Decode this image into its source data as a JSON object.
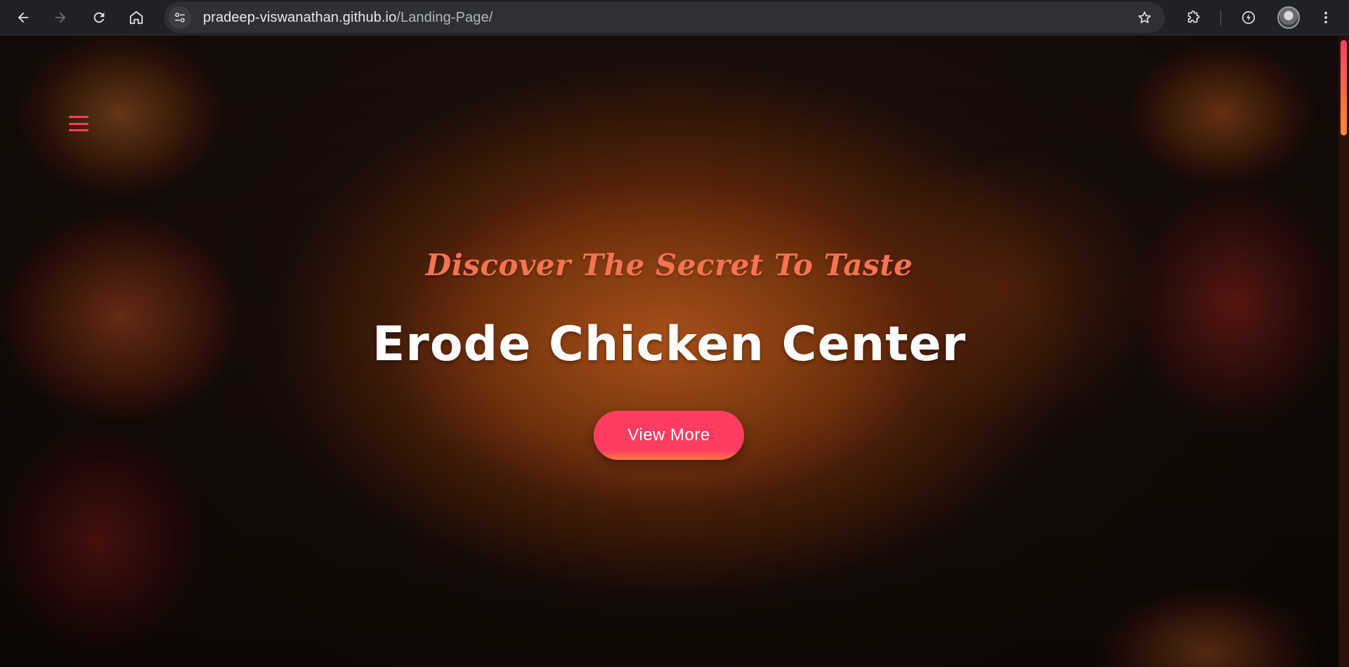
{
  "browser": {
    "url_host": "pradeep-viswanathan.github.io",
    "url_path": "/Landing-Page/",
    "icons": {
      "back": "arrow-left-icon",
      "forward": "arrow-right-icon",
      "reload": "reload-icon",
      "home": "home-icon",
      "site_info": "tune-icon",
      "bookmark": "star-icon",
      "extensions": "puzzle-icon",
      "performance": "lightning-icon",
      "profile": "avatar",
      "menu": "kebab-icon"
    }
  },
  "page": {
    "menu_icon": "hamburger-icon",
    "hero": {
      "tagline": "Discover The Secret To Taste",
      "title": "Erode Chicken Center",
      "cta_label": "View More"
    },
    "colors": {
      "accent": "#ff3c64",
      "tagline": "#f5734f",
      "title": "#ffffff",
      "cta_gradient_end": "#ff7a3d"
    }
  }
}
